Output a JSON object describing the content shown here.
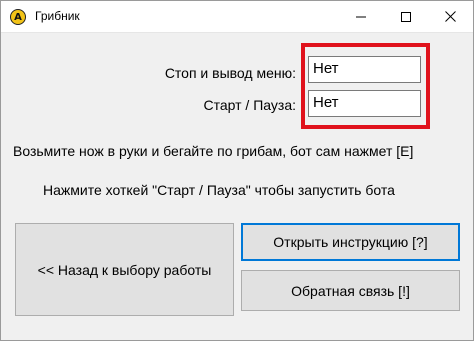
{
  "window": {
    "title": "Грибник",
    "icon_letter": "A",
    "minimize_icon": "minimize-icon",
    "maximize_icon": "maximize-icon",
    "close_icon": "close-icon"
  },
  "form": {
    "stop_label": "Стоп и вывод меню:",
    "stop_value": "Нет",
    "start_label": "Старт / Пауза:",
    "start_value": "Нет"
  },
  "info": {
    "line1": "Возьмите нож в руки и бегайте по грибам, бот сам нажмет [E]",
    "line2": "Нажмите хоткей \"Старт / Пауза\" чтобы запустить бота"
  },
  "buttons": {
    "back": "<< Назад к выбору работы",
    "instructions": "Открыть инструкцию [?]",
    "feedback": "Обратная связь [!]"
  },
  "colors": {
    "highlight": "#e0121c",
    "focus": "#0078d7",
    "app_icon": "#f2c318"
  }
}
